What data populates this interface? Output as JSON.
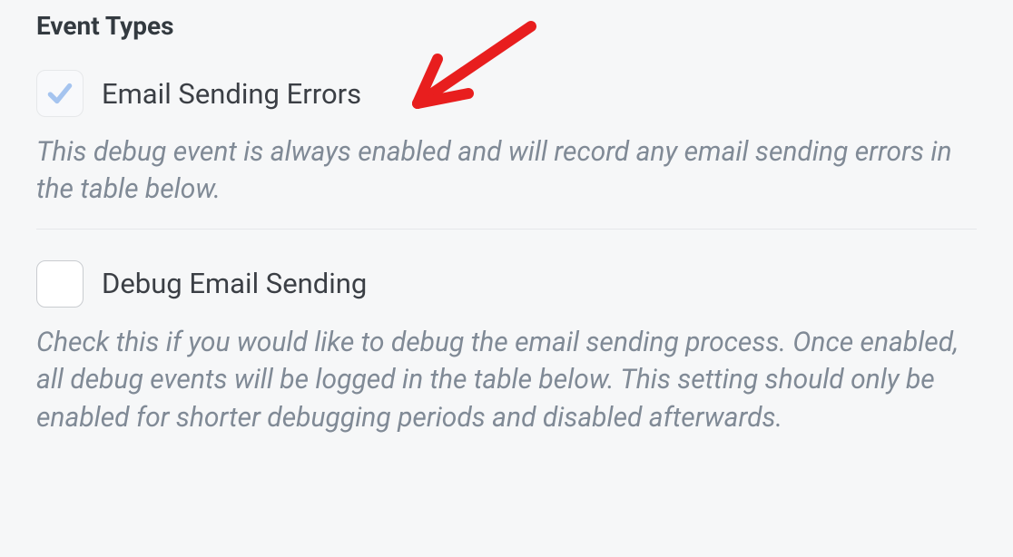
{
  "section": {
    "title": "Event Types"
  },
  "options": {
    "errors": {
      "label": "Email Sending Errors",
      "description": "This debug event is always enabled and will record any email sending errors in the table below.",
      "checked": true
    },
    "debug": {
      "label": "Debug Email Sending",
      "description": "Check this if you would like to debug the email sending process. Once enabled, all debug events will be logged in the table below. This setting should only be enabled for shorter debugging periods and disabled afterwards.",
      "checked": false
    }
  }
}
